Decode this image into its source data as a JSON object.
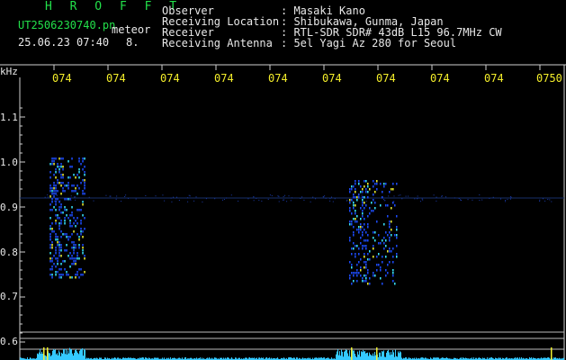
{
  "header": {
    "station_name": "H R O F F T",
    "filename": "UT2506230740.pn",
    "datetime": "25.06.23 07:40",
    "meteor_label": "meteor",
    "meteor_count": "8.",
    "info": [
      {
        "key": "Observer",
        "value": ": Masaki Kano"
      },
      {
        "key": "Receiving Location",
        "value": ": Shibukawa, Gunma, Japan"
      },
      {
        "key": "Receiver",
        "value": ": RTL-SDR SDR# 43dB L15 96.7MHz CW"
      },
      {
        "key": "Receiving Antenna",
        "value": ": 5el Yagi Az 280 for Seoul"
      }
    ]
  },
  "axis": {
    "unit": "kHz",
    "y_ticks": [
      "1.1",
      "1.0",
      "0.9",
      "0.8",
      "0.7",
      "0.6"
    ],
    "time_ticks": [
      "074",
      "074",
      "074",
      "074",
      "074",
      "074",
      "074",
      "074",
      "074",
      "0750"
    ]
  },
  "colors": {
    "background": "#000000",
    "header_green": "#22e04a",
    "time_yellow": "#f4ee2a",
    "echo_blue": "#1d4cff",
    "echo_cyan": "#39e6ff",
    "echo_yellow": "#f0f030"
  },
  "echoes": [
    {
      "name": "meteor-echo-1",
      "t_start": 0.055,
      "t_end": 0.12,
      "f_high": 1.01,
      "f_low": 0.74,
      "intensity": 0.8
    },
    {
      "name": "meteor-echo-2",
      "t_start": 0.605,
      "t_end": 0.695,
      "f_high": 0.96,
      "f_low": 0.73,
      "intensity": 0.6
    }
  ]
}
